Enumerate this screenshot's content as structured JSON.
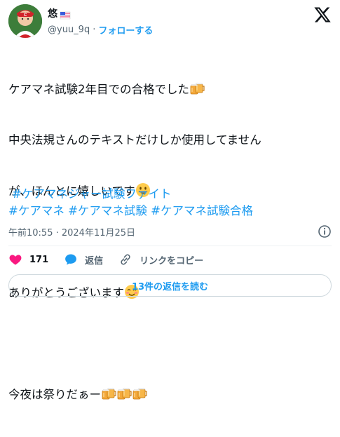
{
  "author": {
    "display_name": "悠",
    "handle": "@yuu_9q",
    "separator": "·",
    "follow_label": "フォローする"
  },
  "tweet": {
    "line1": "ケアマネ試験2年目での合格でした",
    "line2": "中央法規さんのテキストだけしか使用してません",
    "line3": "が、ほんとに嬉しいです",
    "line4": "ありがとうございます",
    "line5": "今夜は祭りだぁー",
    "hashtags": [
      "#ケアマネジャー試験ファイト",
      "#ケアマネ",
      "#ケアマネ試験",
      "#ケアマネ試験合格"
    ]
  },
  "meta": {
    "timestamp": "午前10:55 · 2024年11月25日"
  },
  "actions": {
    "like_count": "171",
    "reply_label": "返信",
    "copy_link_label": "リンクをコピー"
  },
  "read_replies_label": "13件の返信を読む",
  "icons": {
    "beer": "beer-mugs-emoji",
    "grin": "grinning-face-emoji",
    "blush": "smiling-face-emoji",
    "like": "heart-icon",
    "reply": "speech-bubble-icon",
    "link": "link-icon",
    "info": "info-icon",
    "brand": "x-logo"
  },
  "colors": {
    "accent": "#1d9bf0",
    "like": "#f91880",
    "text": "#0f1419",
    "muted": "#536471"
  }
}
